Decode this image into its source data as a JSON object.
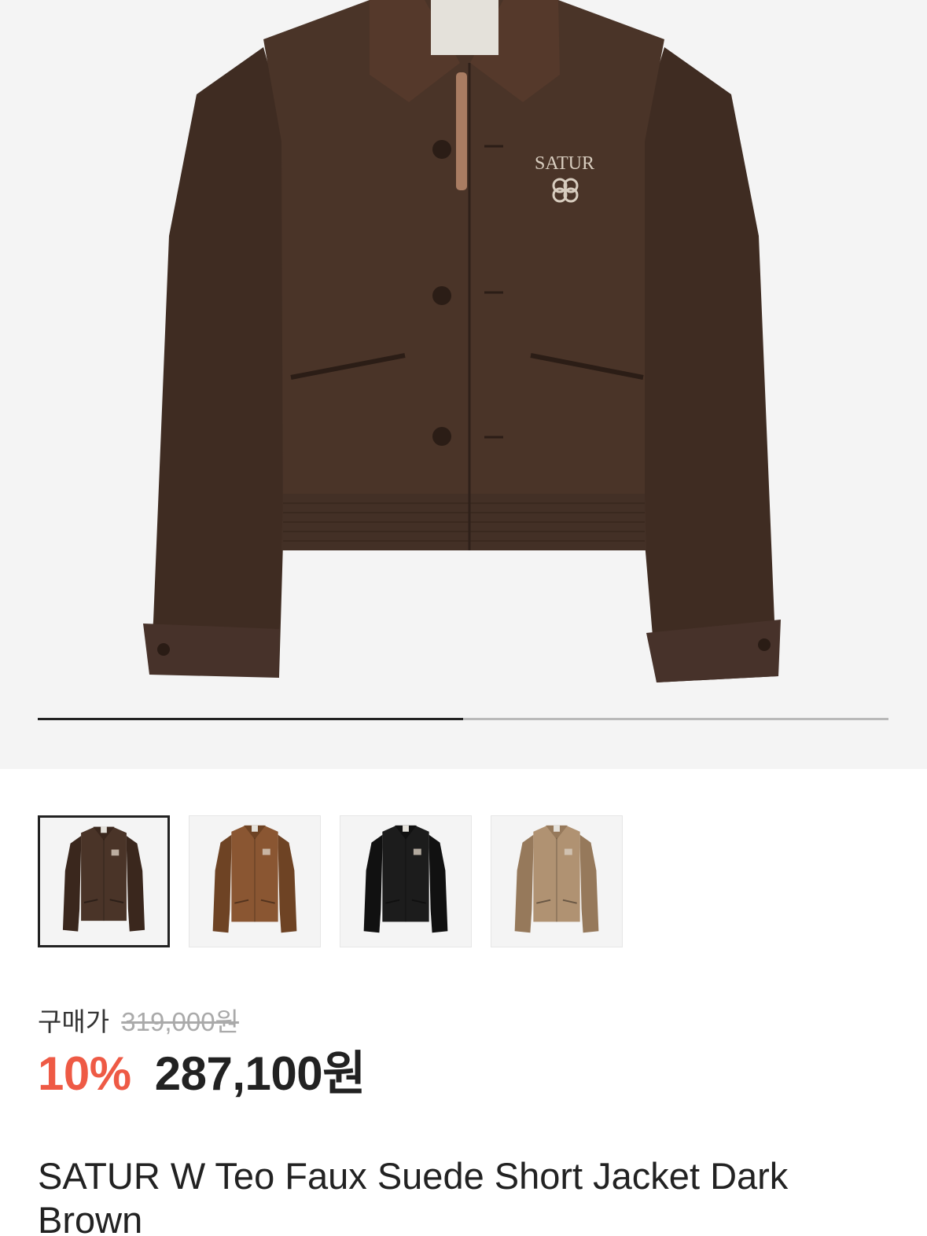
{
  "gallery": {
    "slide_progress_percent": 50,
    "main_image_label": "SATUR",
    "thumbnails": [
      {
        "color_name": "dark-brown",
        "body": "#4a3428",
        "shade": "#3a271d",
        "selected": true
      },
      {
        "color_name": "brown",
        "body": "#8a5632",
        "shade": "#6e4324",
        "selected": false
      },
      {
        "color_name": "black",
        "body": "#1c1c1c",
        "shade": "#111111",
        "selected": false
      },
      {
        "color_name": "beige",
        "body": "#b09272",
        "shade": "#96795b",
        "selected": false
      }
    ]
  },
  "price": {
    "label": "구매가",
    "original": "319,000원",
    "discount": "10%",
    "sale": "287,100원"
  },
  "product": {
    "title": "SATUR W Teo Faux Suede Short Jacket Dark Brown"
  },
  "colors": {
    "discount_red": "#ee5a45",
    "text_dark": "#222222",
    "strike_gray": "#aaaaaa"
  }
}
